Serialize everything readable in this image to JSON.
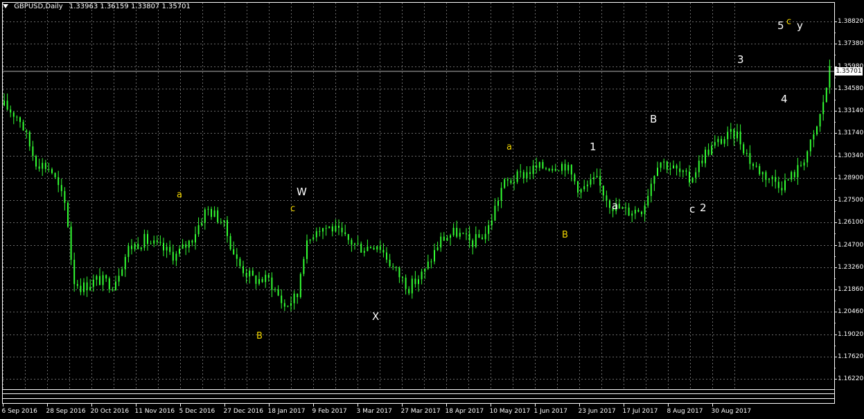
{
  "header": {
    "symbol": "GBPUSD,Daily",
    "ohlc": "1.33963 1.36159 1.33807 1.35701"
  },
  "price_axis": {
    "labels": [
      "1.38820",
      "1.37380",
      "1.35980",
      "1.34580",
      "1.33140",
      "1.31740",
      "1.30340",
      "1.28900",
      "1.27500",
      "1.26100",
      "1.24700",
      "1.23260",
      "1.21860",
      "1.20460",
      "1.19020",
      "1.17620",
      "1.16220"
    ],
    "current_price": "1.35701"
  },
  "time_axis": {
    "labels": [
      "6 Sep 2016",
      "28 Sep 2016",
      "20 Oct 2016",
      "11 Nov 2016",
      "5 Dec 2016",
      "27 Dec 2016",
      "18 Jan 2017",
      "9 Feb 2017",
      "3 Mar 2017",
      "27 Mar 2017",
      "18 Apr 2017",
      "10 May 2017",
      "1 Jun 2017",
      "23 Jun 2017",
      "17 Jul 2017",
      "8 Aug 2017",
      "30 Aug 2017"
    ]
  },
  "wave_labels": [
    {
      "text": "a",
      "color": "yellow"
    },
    {
      "text": "B",
      "color": "yellow"
    },
    {
      "text": "c",
      "color": "yellow"
    },
    {
      "text": "W",
      "color": "white"
    },
    {
      "text": "X",
      "color": "white"
    },
    {
      "text": "a",
      "color": "yellow"
    },
    {
      "text": "B",
      "color": "yellow"
    },
    {
      "text": "1",
      "color": "white"
    },
    {
      "text": "a",
      "color": "white"
    },
    {
      "text": "B",
      "color": "white"
    },
    {
      "text": "c",
      "color": "white"
    },
    {
      "text": "2",
      "color": "white"
    },
    {
      "text": "3",
      "color": "white"
    },
    {
      "text": "4",
      "color": "white"
    },
    {
      "text": "5",
      "color": "white"
    },
    {
      "text": "c",
      "color": "yellow"
    },
    {
      "text": "y",
      "color": "white"
    }
  ],
  "colors": {
    "background": "#000000",
    "candles": "#33ff33",
    "grid": "#6b6b6b",
    "axis_text": "#ffffff",
    "wave_yellow": "#f5d800",
    "wave_white": "#ffffff"
  },
  "chart_data": {
    "type": "line",
    "title": "GBPUSD,Daily",
    "x_range": [
      "6 Sep 2016",
      "12 Sep 2017"
    ],
    "ylim": [
      1.1622,
      1.3882
    ],
    "grid": true,
    "series": [
      {
        "name": "GBPUSD",
        "x": [
          "6 Sep 2016",
          "13 Sep 2016",
          "20 Sep 2016",
          "27 Sep 2016",
          "4 Oct 2016",
          "7 Oct 2016",
          "11 Oct 2016",
          "18 Oct 2016",
          "25 Oct 2016",
          "1 Nov 2016",
          "8 Nov 2016",
          "15 Nov 2016",
          "22 Nov 2016",
          "29 Nov 2016",
          "6 Dec 2016",
          "13 Dec 2016",
          "20 Dec 2016",
          "27 Dec 2016",
          "3 Jan 2017",
          "10 Jan 2017",
          "16 Jan 2017",
          "18 Jan 2017",
          "24 Jan 2017",
          "31 Jan 2017",
          "7 Feb 2017",
          "14 Feb 2017",
          "21 Feb 2017",
          "28 Feb 2017",
          "7 Mar 2017",
          "14 Mar 2017",
          "21 Mar 2017",
          "28 Mar 2017",
          "4 Apr 2017",
          "11 Apr 2017",
          "18 Apr 2017",
          "25 Apr 2017",
          "2 May 2017",
          "9 May 2017",
          "16 May 2017",
          "23 May 2017",
          "30 May 2017",
          "6 Jun 2017",
          "13 Jun 2017",
          "20 Jun 2017",
          "27 Jun 2017",
          "4 Jul 2017",
          "11 Jul 2017",
          "18 Jul 2017",
          "25 Jul 2017",
          "1 Aug 2017",
          "8 Aug 2017",
          "15 Aug 2017",
          "22 Aug 2017",
          "29 Aug 2017",
          "5 Sep 2017",
          "8 Sep 2017",
          "12 Sep 2017"
        ],
        "values": [
          1.335,
          1.327,
          1.3,
          1.295,
          1.27,
          1.225,
          1.22,
          1.225,
          1.222,
          1.245,
          1.25,
          1.245,
          1.24,
          1.25,
          1.27,
          1.262,
          1.235,
          1.225,
          1.225,
          1.208,
          1.215,
          1.24,
          1.258,
          1.258,
          1.25,
          1.245,
          1.248,
          1.232,
          1.22,
          1.23,
          1.25,
          1.255,
          1.248,
          1.255,
          1.285,
          1.29,
          1.295,
          1.297,
          1.298,
          1.281,
          1.288,
          1.272,
          1.268,
          1.27,
          1.301,
          1.295,
          1.288,
          1.305,
          1.313,
          1.318,
          1.298,
          1.29,
          1.285,
          1.295,
          1.315,
          1.33,
          1.357
        ]
      }
    ]
  }
}
